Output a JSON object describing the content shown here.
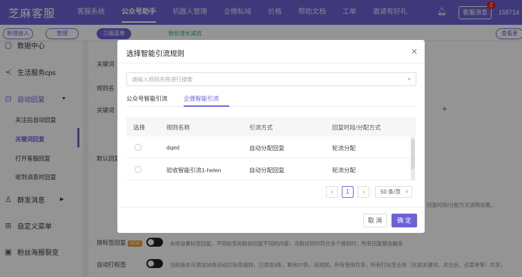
{
  "topbar": {
    "brand": "芝麻客服",
    "nav": [
      "客服系统",
      "公众号助手",
      "机器人管理",
      "企微私域",
      "价格",
      "帮助文档",
      "工单",
      "邀请有好礼"
    ],
    "kf_button": "客服消息",
    "kf_badge": "2",
    "account_number": "158714"
  },
  "subbar": {
    "left_pill_1": "新增接入",
    "left_pill_2": "管理",
    "pill_active": "三级菜单",
    "pill_green": "粉丝增长减流",
    "right_pill": "查看更"
  },
  "sidebar": {
    "top_partial": "数据中心",
    "items": [
      {
        "label": "生活服务cps"
      },
      {
        "label": "自动回复"
      },
      {
        "label": "关注后自动回复"
      },
      {
        "label": "关键词回复"
      },
      {
        "label": "打开客服回复"
      },
      {
        "label": "收到消息时回复"
      },
      {
        "label": "群发消息"
      },
      {
        "label": "自定义菜单"
      },
      {
        "label": "粉丝海报裂变"
      }
    ]
  },
  "content": {
    "label_keyword": "关键词",
    "label_rule": "规则名",
    "label_keyword2": "关键词",
    "label_default": "默认回复",
    "label_tag_reply": "按标签回复",
    "tag_badge": "NEW",
    "tag_reply_desc": "未经设置标签回复，不同标签的粉丝回复不同的内容，当粉丝同时符合多个规则时，所有回复都会触发",
    "label_auto_tag": "自动打标签",
    "auto_tag_desc_1": "当前版本可添加",
    "auto_tag_desc_2": "30",
    "auto_tag_desc_3": "条自动打标签规则，已添加",
    "auto_tag_desc_4": "3",
    "auto_tag_desc_5": "条，剩余",
    "auto_tag_desc_6": "27",
    "auto_tag_desc_7": "条。该规则，所有使用共享，所有打标签业务（比如关键词、关注后、点菜单等）共享。",
    "behind_note": "回复时段/分配方式说明设置。"
  },
  "modal": {
    "title": "选择智能引流规则",
    "search_placeholder": "请输入规则名称进行搜索",
    "tabs": [
      "公众号智能引流",
      "企微智能引流"
    ],
    "columns": [
      "选择",
      "规则名称",
      "引流方式",
      "回复时段/分配方式"
    ],
    "rows": [
      {
        "name": "dqed",
        "method": "自动分配回复",
        "mode": "轮流分配"
      },
      {
        "name": "验收智能引流1-helen",
        "method": "自动分配回复",
        "mode": "轮流分配"
      }
    ],
    "pagination": {
      "current": "1",
      "page_size": "50 条/页"
    },
    "cancel": "取 消",
    "ok": "确 定"
  }
}
